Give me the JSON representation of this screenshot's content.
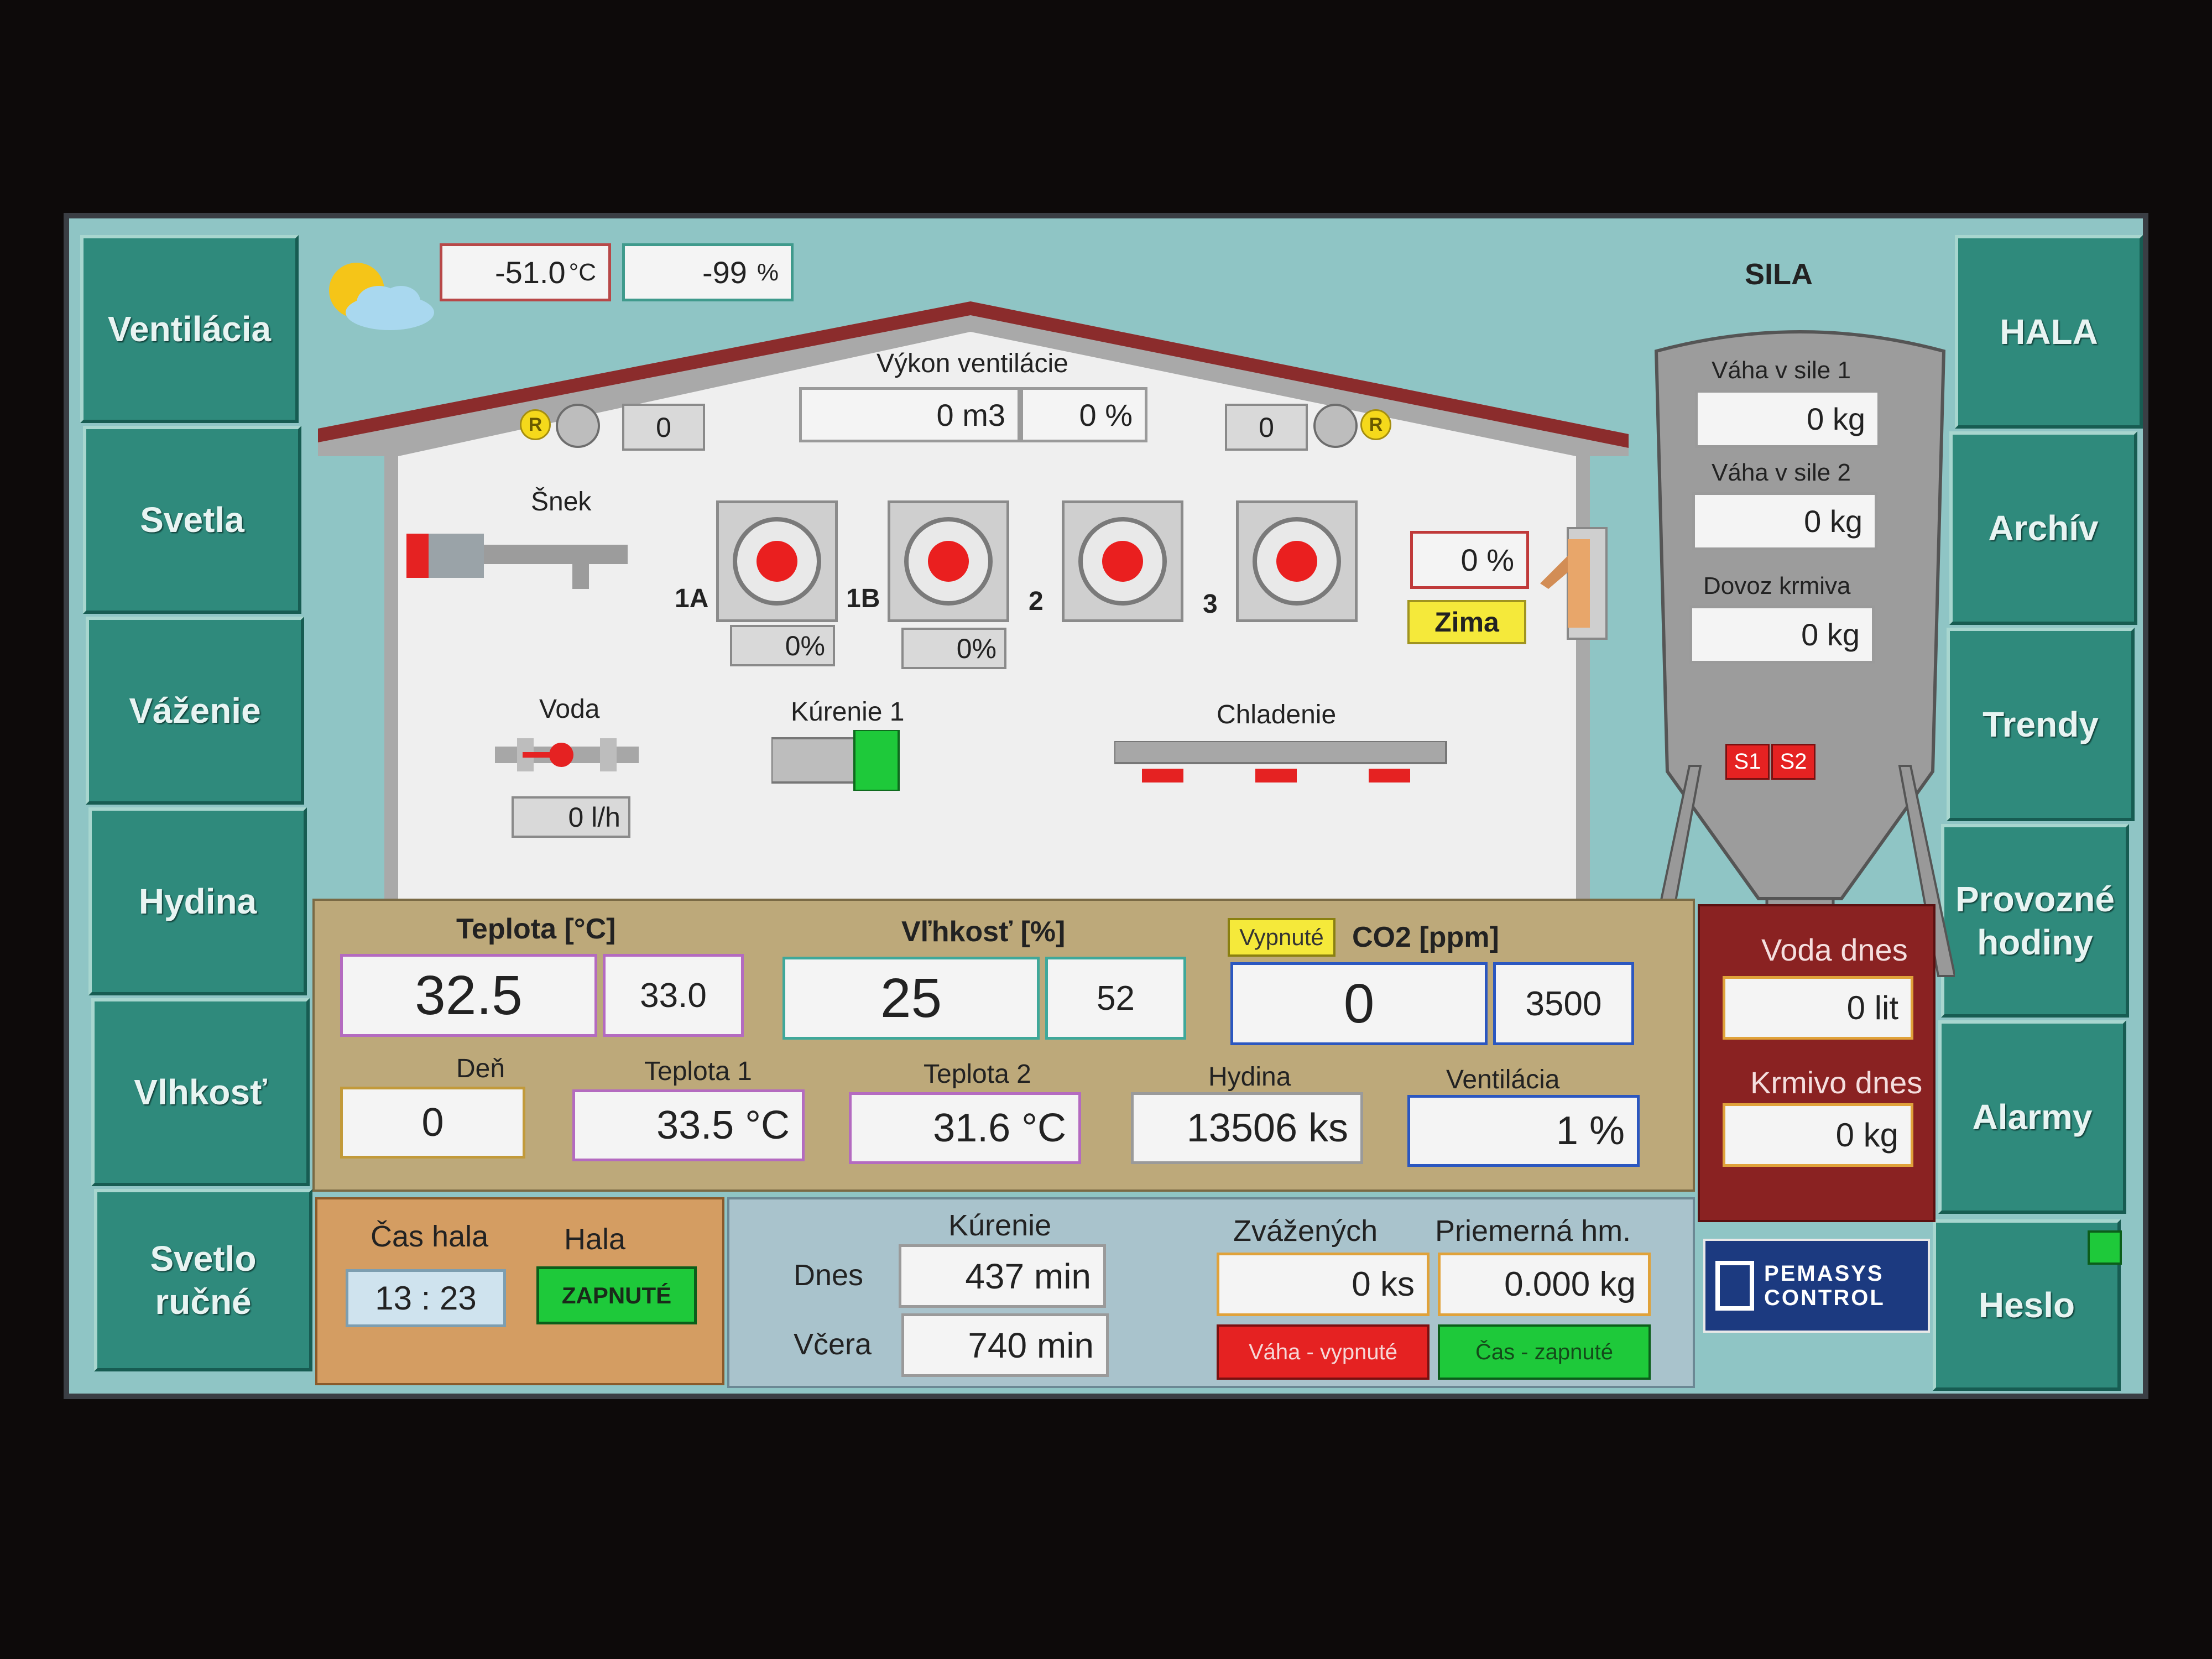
{
  "nav_left": [
    "Ventilácia",
    "Svetla",
    "Váženie",
    "Hydina",
    "Vlhkosť",
    "Svetlo ručné"
  ],
  "nav_right": [
    "HALA",
    "Archív",
    "Trendy",
    "Provozné hodiny",
    "Alarmy",
    "Heslo"
  ],
  "outside": {
    "temperature": "-51.0",
    "temp_unit": "°C",
    "humidity": "-99",
    "hum_unit": "%"
  },
  "hall": {
    "ventilation_power_label": "Výkon ventilácie",
    "flow_value": "0 m3",
    "power_pct": "0 %",
    "left_counter": "0",
    "right_counter": "0",
    "r_badge": "R",
    "snek_label": "Šnek",
    "fans": [
      {
        "label": "1A",
        "pct": "0%"
      },
      {
        "label": "1B",
        "pct": "0%"
      },
      {
        "label": "2",
        "pct": ""
      },
      {
        "label": "3",
        "pct": ""
      }
    ],
    "inlet_pct": "0 %",
    "mode": "Zima",
    "voda_label": "Voda",
    "voda_value": "0 l/h",
    "heating_label": "Kúrenie 1",
    "cooling_label": "Chladenie"
  },
  "silo": {
    "title": "SILA",
    "weight1_label": "Váha v sile 1",
    "weight1": "0 kg",
    "weight2_label": "Váha v sile 2",
    "weight2": "0 kg",
    "feed_label": "Dovoz krmiva",
    "feed": "0 kg",
    "s1": "S1",
    "s2": "S2"
  },
  "climate": {
    "temp_label": "Teplota [°C]",
    "temp_actual": "32.5",
    "temp_set": "33.0",
    "hum_label": "Vľhkosť [%]",
    "hum_actual": "25",
    "hum_set": "52",
    "co2_status": "Vypnuté",
    "co2_label": "CO2 [ppm]",
    "co2_actual": "0",
    "co2_set": "3500",
    "day_label": "Deň",
    "day": "0",
    "t1_label": "Teplota 1",
    "t1": "33.5 °C",
    "t2_label": "Teplota 2",
    "t2": "31.6 °C",
    "birds_label": "Hydina",
    "birds": "13506 ks",
    "vent_label": "Ventilácia",
    "vent": "1 %"
  },
  "today": {
    "water_label": "Voda dnes",
    "water": "0 lit",
    "feed_label": "Krmivo dnes",
    "feed": "0 kg"
  },
  "time": {
    "label": "Čas hala",
    "value": "13 : 23",
    "hall_label": "Hala",
    "hall_status": "ZAPNUTÉ"
  },
  "heating": {
    "label": "Kúrenie",
    "today_label": "Dnes",
    "today": "437 min",
    "yesterday_label": "Včera",
    "yesterday": "740 min"
  },
  "weighing": {
    "weighed_label": "Zvážených",
    "weighed": "0 ks",
    "avg_label": "Priemerná hm.",
    "avg": "0.000 kg",
    "scale_status": "Váha - vypnuté",
    "time_status": "Čas - zapnuté"
  },
  "logo": {
    "line1": "PEMASYS",
    "line2": "CONTROL"
  },
  "colors": {
    "panel": "#2f8a7c",
    "screen_bg": "#8fc5c5",
    "climate_bg": "#bda97a",
    "today_bg": "#8a2222",
    "time_bg": "#d49d62",
    "heat_bg": "#a9c3cc",
    "alarm_red": "#e52222",
    "ok_green": "#1ec93a"
  }
}
